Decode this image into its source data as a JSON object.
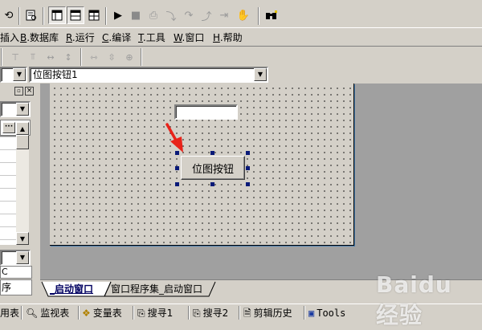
{
  "toolbar": {
    "icons": [
      "undo-icon",
      "preview-icon",
      "layout-window-icon",
      "layout-split-icon",
      "layout-grid-icon",
      "run-icon",
      "stop-icon",
      "step-icon",
      "step-into-icon",
      "step-over-icon",
      "step-out-icon",
      "run-to-cursor-icon",
      "breakpoint-hand-icon",
      "find-binoculars-icon"
    ]
  },
  "menu": {
    "insert": "插入",
    "database_key": "B",
    "database": ".数据库",
    "run_key": "R",
    "run": ".运行",
    "compile_key": "C",
    "compile": ".编译",
    "tools_key": "T",
    "tools": ".工具",
    "window_key": "W",
    "window": ".窗口",
    "help_key": "H",
    "help": ".帮助"
  },
  "component_selector": {
    "value": "位图按钮1"
  },
  "left_panel": {
    "bottom_label_1": "C",
    "bottom_label_2": "序"
  },
  "form": {
    "button_label": "位图按钮"
  },
  "tabs": {
    "startup_window": "_启动窗口",
    "window_program": "窗口程序集_启动窗口"
  },
  "bottom_tabs": {
    "t0": "用表",
    "t1": "监视表",
    "t2": "变量表",
    "t3": "搜寻1",
    "t4": "搜寻2",
    "t5": "剪辑历史",
    "t6": "Tools"
  },
  "watermark": "Baidu 经验",
  "colors": {
    "selection_handle": "#0a1a78",
    "arrow": "#e8231a",
    "design_background": "#a0a0a0",
    "window_chrome": "#d4d0c8"
  }
}
